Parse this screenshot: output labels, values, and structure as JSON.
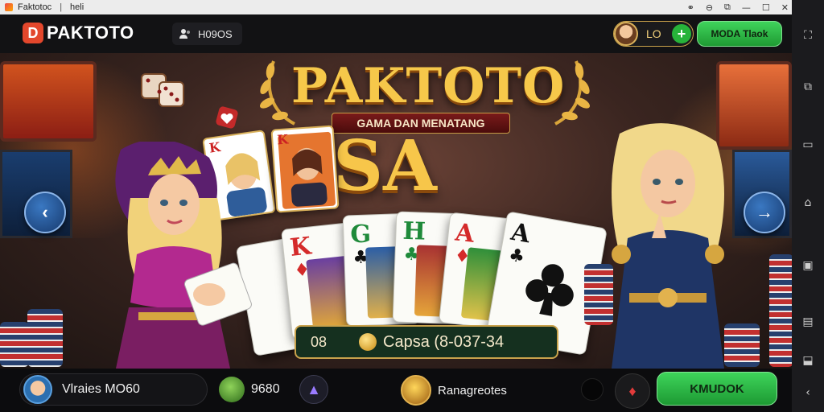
{
  "window": {
    "title": "Faktotoc",
    "subtitle": "heli",
    "controls": [
      "⚭",
      "⊖",
      "⧉",
      "—",
      "☐",
      "✕"
    ]
  },
  "header": {
    "logo_mark": "D",
    "logo_text": "PAKTOTO",
    "online_icon": "players-icon",
    "online_text": "H09OS",
    "user_level": "LO",
    "plus_label": "+",
    "mode_button": "MODA Tlaok"
  },
  "hero": {
    "title": "PAKTOTO",
    "subtitle": "GAMA DAN MENATANG",
    "big_title": "SA SEU",
    "face_cards": [
      {
        "rank": "K"
      },
      {
        "rank": "K"
      }
    ],
    "cards": [
      {
        "rank": "K",
        "suit": "♦",
        "color": "red"
      },
      {
        "rank": "G",
        "suit": "♣",
        "color": "grn"
      },
      {
        "rank": "H",
        "suit": "♣",
        "color": "grn"
      },
      {
        "rank": "A",
        "suit": "♦",
        "color": "red"
      },
      {
        "rank": "A",
        "suit": "♣",
        "color": "blk"
      }
    ],
    "info_number": "08",
    "info_game": "Capsa (8-037-34"
  },
  "nav": {
    "prev": "‹",
    "next": "→"
  },
  "bottom": {
    "profile_name": "Vlraies MO60",
    "coin_value": "9680",
    "gem_icon": "▲",
    "rank_label": "Ranagreotes",
    "red_icon": "♦",
    "play_label": "KMUDOK"
  },
  "sysbar": {
    "icons": [
      "⛶",
      "⧉",
      "▭",
      "⌂",
      "▣",
      "▤",
      "⬓",
      "‹"
    ]
  },
  "colors": {
    "accent_gold": "#f6c84a",
    "accent_green": "#27b33a",
    "logo_red": "#e3472c",
    "nav_blue": "#3a78c2"
  }
}
